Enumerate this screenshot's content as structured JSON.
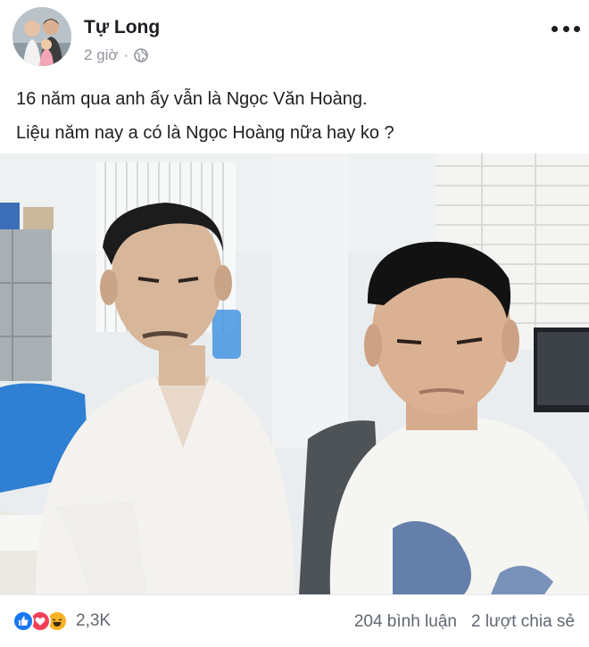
{
  "post": {
    "author": "Tự Long",
    "time": "2 giờ",
    "separator": "·",
    "privacy_icon": "globe-icon",
    "more_icon": "more-options-icon",
    "caption_lines": [
      "16 năm qua anh ấy vẫn là Ngọc Văn Hoàng.",
      "Liệu năm nay a có là Ngọc Hoàng nữa hay ko ?"
    ]
  },
  "footer": {
    "reaction_icons": [
      "like-icon",
      "love-icon",
      "haha-icon"
    ],
    "reaction_count": "2,3K",
    "comments": "204 bình luận",
    "shares": "2 lượt chia sẻ"
  },
  "colors": {
    "like": "#1877f2",
    "love": "#f33e58",
    "haha": "#f7b125",
    "text": "#1c1e21",
    "muted": "#90949c"
  }
}
